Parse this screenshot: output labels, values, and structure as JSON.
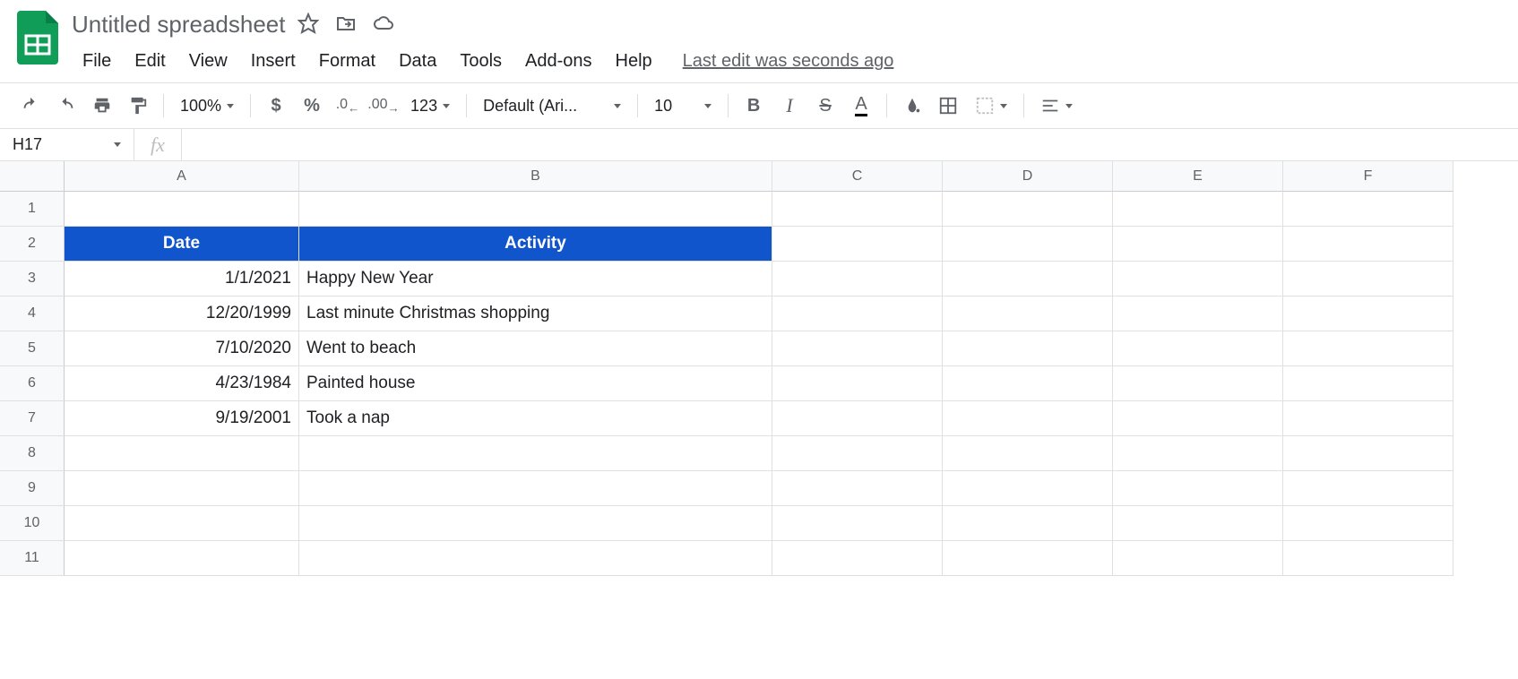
{
  "header": {
    "title": "Untitled spreadsheet",
    "last_edit": "Last edit was seconds ago"
  },
  "menus": [
    "File",
    "Edit",
    "View",
    "Insert",
    "Format",
    "Data",
    "Tools",
    "Add-ons",
    "Help"
  ],
  "toolbar": {
    "zoom": "100%",
    "font": "Default (Ari...",
    "font_size": "10",
    "format_123": "123"
  },
  "formula_bar": {
    "name_box": "H17",
    "fx": "fx"
  },
  "columns": [
    "A",
    "B",
    "C",
    "D",
    "E",
    "F"
  ],
  "rows": [
    "1",
    "2",
    "3",
    "4",
    "5",
    "6",
    "7",
    "8",
    "9",
    "10",
    "11"
  ],
  "sheet": {
    "headers": {
      "date": "Date",
      "activity": "Activity"
    },
    "data": [
      {
        "date": "1/1/2021",
        "activity": "Happy New Year"
      },
      {
        "date": "12/20/1999",
        "activity": "Last minute Christmas shopping"
      },
      {
        "date": "7/10/2020",
        "activity": "Went to beach"
      },
      {
        "date": "4/23/1984",
        "activity": "Painted house"
      },
      {
        "date": "9/19/2001",
        "activity": "Took a nap"
      }
    ]
  }
}
